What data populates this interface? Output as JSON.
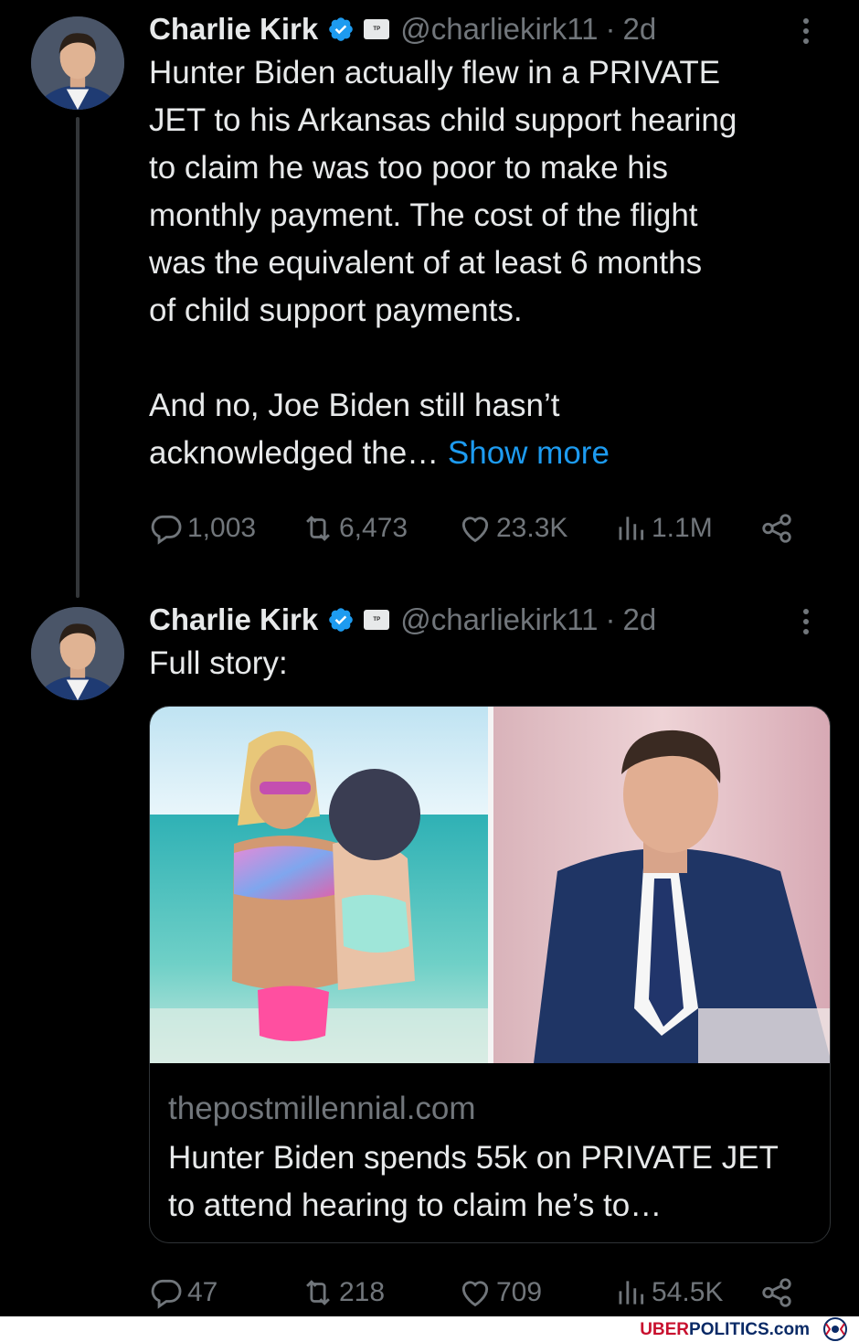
{
  "tweets": [
    {
      "author_name": "Charlie Kirk",
      "handle": "@charliekirk11",
      "separator": "·",
      "time": "2d",
      "text": "Hunter Biden actually flew in a PRIVATE\nJET to his Arkansas child support hearing\nto claim he was too poor to make his\nmonthly payment. The cost of the flight\nwas the equivalent of at least 6 months\nof child support payments.\n\nAnd no, Joe Biden still hasn’t\nacknowledged the… ",
      "show_more": "Show more",
      "replies": "1,003",
      "reposts": "6,473",
      "likes": "23.3K",
      "views": "1.1M"
    },
    {
      "author_name": "Charlie Kirk",
      "handle": "@charliekirk11",
      "separator": "·",
      "time": "2d",
      "text": "Full story:",
      "card": {
        "domain": "thepostmillennial.com",
        "title": "Hunter Biden spends 55k on PRIVATE JET to attend hearing to claim he’s to…"
      },
      "replies": "47",
      "reposts": "218",
      "likes": "709",
      "views": "54.5K"
    }
  ],
  "icons": {
    "verified": "verified-badge-icon",
    "org": "affiliation-badge-icon",
    "reply": "reply-icon",
    "repost": "repost-icon",
    "like": "heart-icon",
    "views": "views-chart-icon",
    "share": "share-icon",
    "more": "more-vertical-icon"
  },
  "watermark": {
    "uber": "UBER",
    "politics": "POLITICS.com"
  },
  "colors": {
    "background": "#000000",
    "text": "#e7e9ea",
    "muted": "#71767b",
    "link": "#1d9bf0",
    "verified": "#1d9bf0"
  }
}
